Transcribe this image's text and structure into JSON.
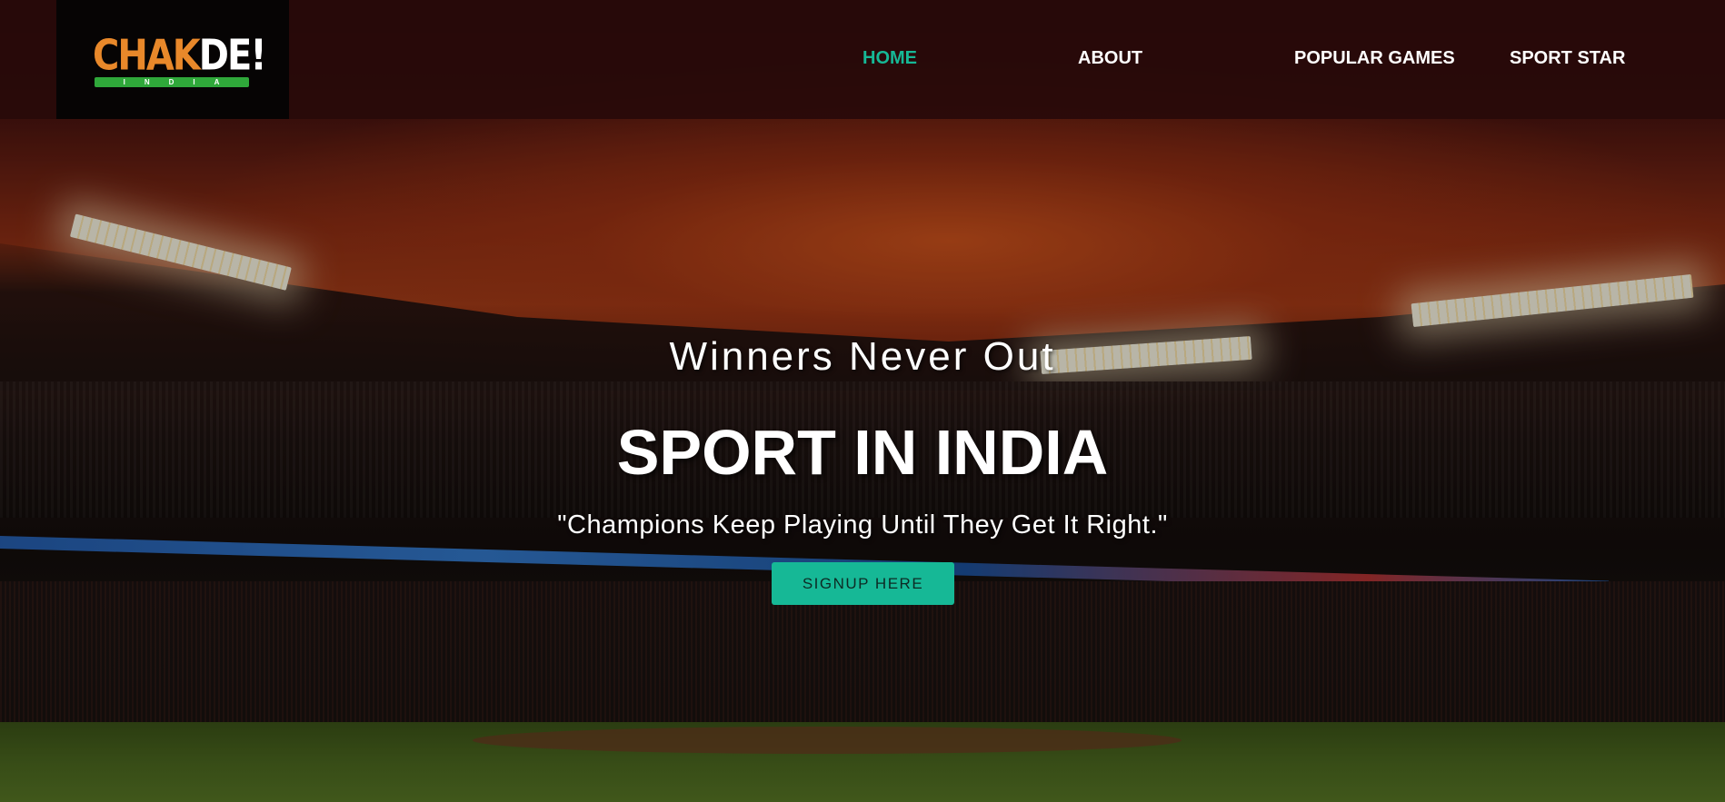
{
  "brand": {
    "logo_word_main": "CHAK",
    "logo_word_accent": "DE!",
    "logo_subtitle": "INDIA"
  },
  "nav": {
    "items": [
      {
        "label": "HOME",
        "active": true
      },
      {
        "label": "ABOUT",
        "active": false
      },
      {
        "label": "POPULAR GAMES",
        "active": false
      },
      {
        "label": "SPORT STAR",
        "active": false
      }
    ]
  },
  "hero": {
    "tagline": "Winners Never Out",
    "title": "SPORT IN INDIA",
    "quote": "\"Champions Keep Playing Until They Get It Right.\"",
    "cta_label": "SIGNUP HERE"
  },
  "colors": {
    "accent": "#16b896",
    "header_bg": "#2a0a0a",
    "logo_orange": "#e8882a",
    "logo_green": "#2fa83a"
  }
}
